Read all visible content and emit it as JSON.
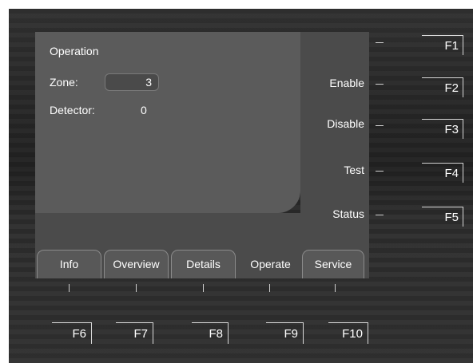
{
  "screen": {
    "title": "Operation",
    "zone_label": "Zone:",
    "zone_value": "3",
    "detector_label": "Detector:",
    "detector_value": "0"
  },
  "soft_actions": [
    "Enable",
    "Disable",
    "Test",
    "Status"
  ],
  "right_keys": [
    "F1",
    "F2",
    "F3",
    "F4",
    "F5"
  ],
  "tabs": [
    {
      "label": "Info",
      "active": false
    },
    {
      "label": "Overview",
      "active": false
    },
    {
      "label": "Details",
      "active": false
    },
    {
      "label": "Operate",
      "active": true
    },
    {
      "label": "Service",
      "active": false
    }
  ],
  "bottom_keys": [
    "F6",
    "F7",
    "F8",
    "F9",
    "F10"
  ]
}
